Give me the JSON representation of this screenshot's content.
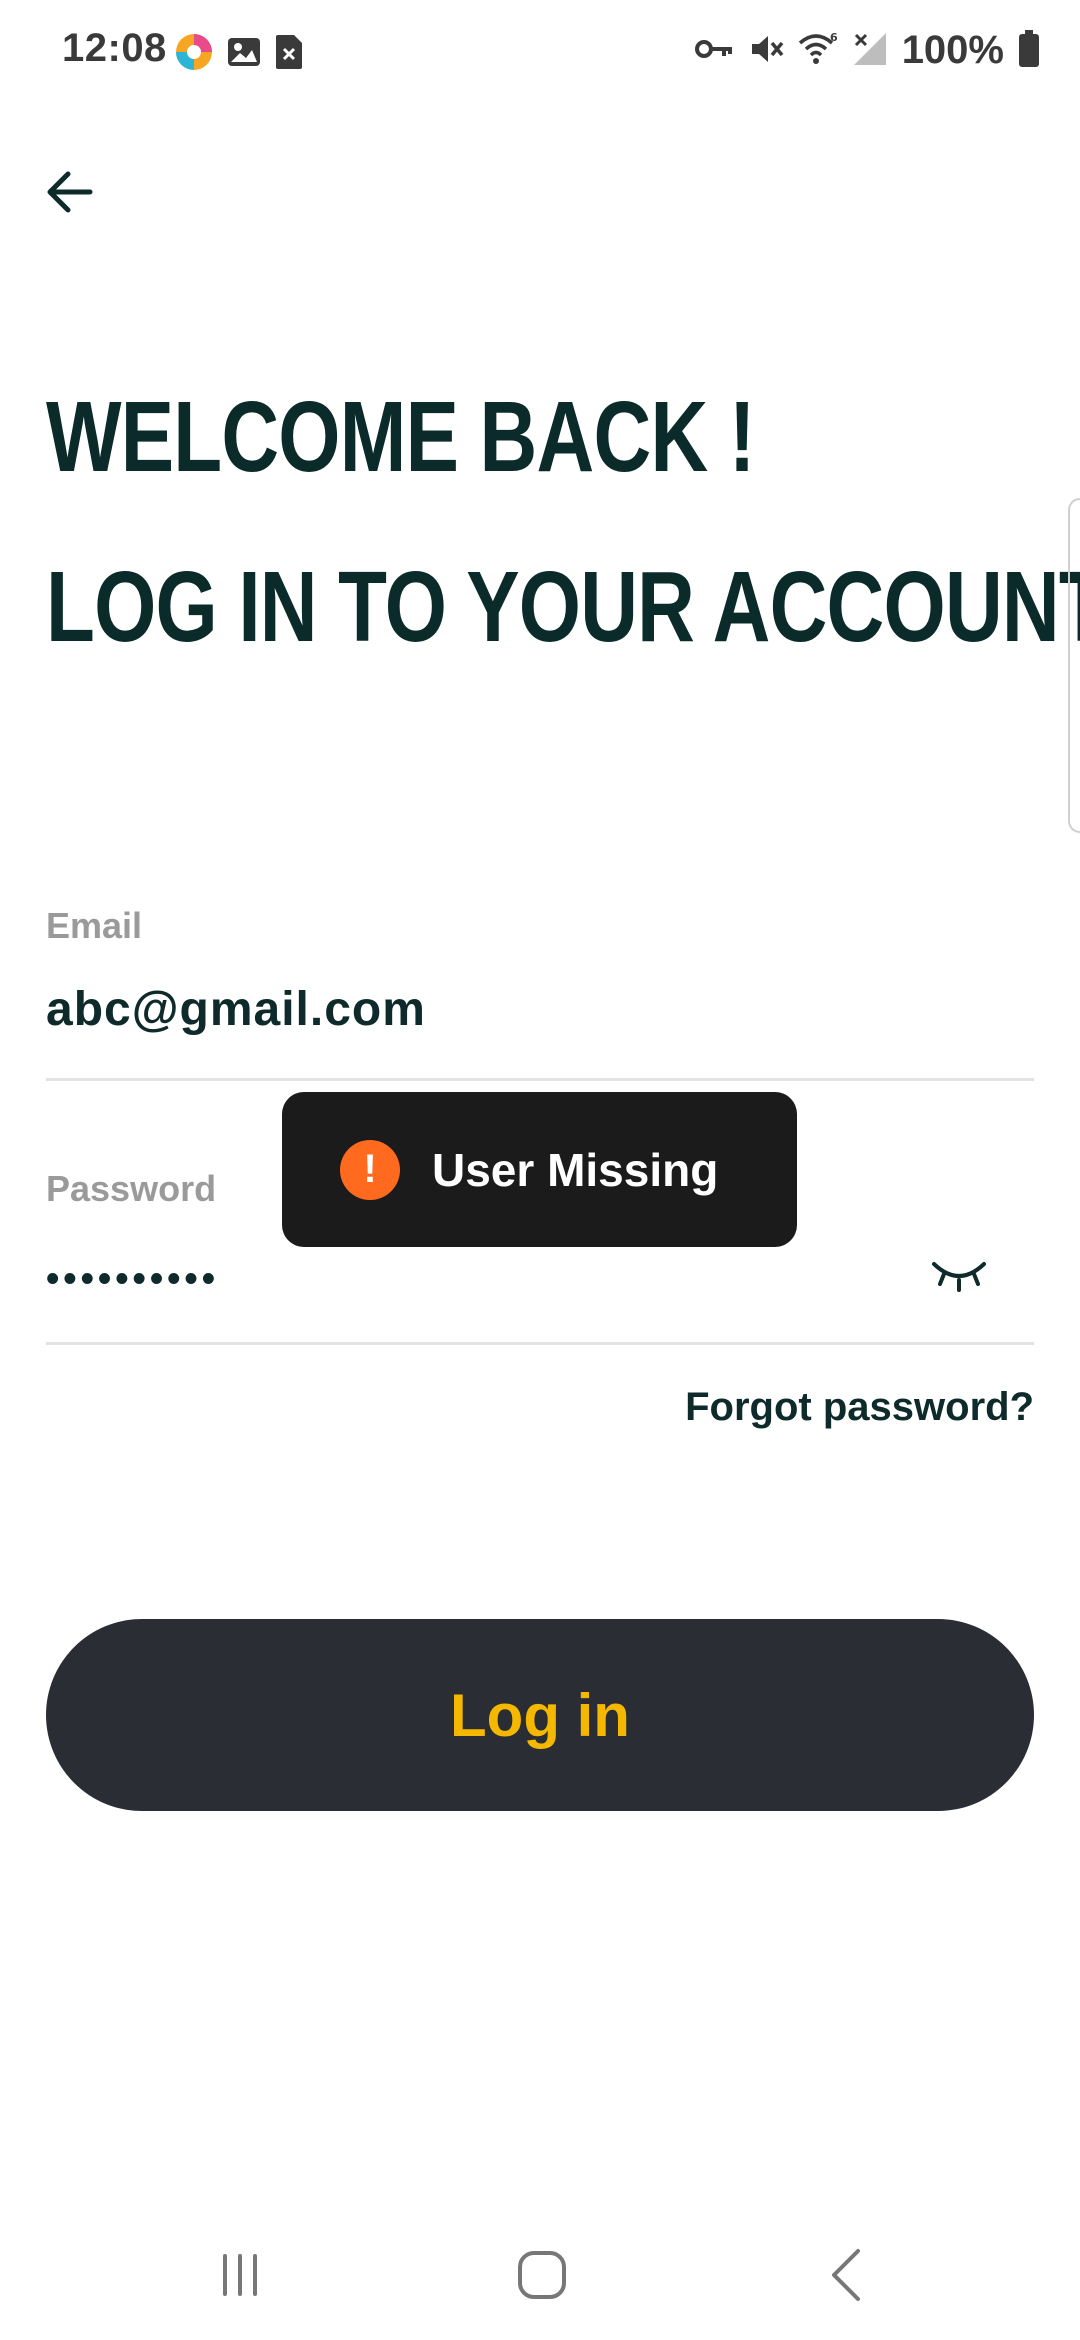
{
  "status_bar": {
    "time": "12:08",
    "battery": "100%",
    "left_icons": [
      "app-color-icon",
      "image-icon",
      "sim-error-icon"
    ],
    "right_icons": [
      "vpn-key-icon",
      "mute-icon",
      "wifi-6-icon",
      "no-signal-icon",
      "battery-icon"
    ]
  },
  "header": {
    "back_icon": "back-arrow-icon",
    "title_line1": "WELCOME BACK !",
    "title_line2": "LOG IN TO YOUR ACCOUNT"
  },
  "form": {
    "email": {
      "label": "Email",
      "value": "abc@gmail.com"
    },
    "password": {
      "label": "Password",
      "value": "••••••••••",
      "toggle_icon": "eye-closed-icon"
    },
    "forgot_link": "Forgot password?",
    "login_button": "Log in"
  },
  "toast": {
    "icon": "!",
    "message": "User Missing"
  },
  "colors": {
    "title": "#0b2a2a",
    "button_bg": "#2a2d34",
    "button_text": "#f5b800",
    "toast_bg": "#1b1b1b",
    "toast_icon": "#ff6a1f",
    "label": "#9a9a9a"
  },
  "nav_bar": {
    "items": [
      "recents-icon",
      "home-icon",
      "back-icon"
    ]
  }
}
